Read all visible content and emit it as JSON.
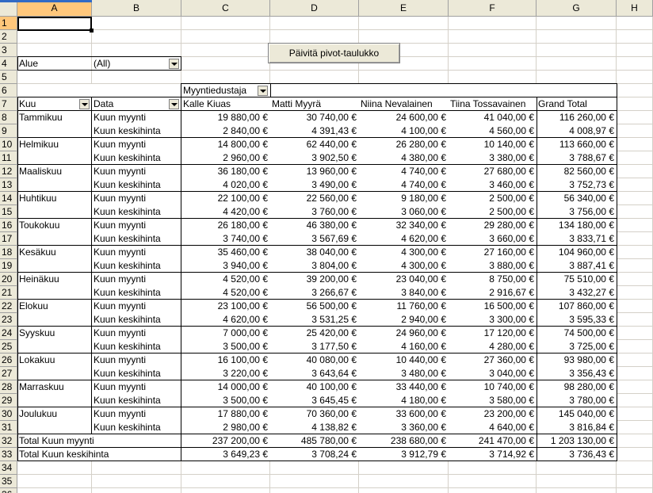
{
  "columns": [
    "A",
    "B",
    "C",
    "D",
    "E",
    "F",
    "G",
    "H"
  ],
  "rows": [
    "1",
    "2",
    "3",
    "4",
    "5",
    "6",
    "7",
    "8",
    "9",
    "10",
    "11",
    "12",
    "13",
    "14",
    "15",
    "16",
    "17",
    "18",
    "19",
    "20",
    "21",
    "22",
    "23",
    "24",
    "25",
    "26",
    "27",
    "28",
    "29",
    "30",
    "31",
    "32",
    "33",
    "34",
    "35",
    "36"
  ],
  "refresh_button": "Päivitä pivot-taulukko",
  "page_field": {
    "label": "Alue",
    "value": "(All)"
  },
  "column_field": "Myyntiedustaja",
  "row_fields": [
    "Kuu",
    "Data"
  ],
  "salespeople": [
    "Kalle  Kiuas",
    "Matti Myyrä",
    "Niina Nevalainen",
    "Tiina Tossavainen",
    "Grand Total"
  ],
  "months": [
    {
      "name": "Tammikuu",
      "sales": [
        "19 880,00 €",
        "30 740,00 €",
        "24 600,00 €",
        "41 040,00 €",
        "116 260,00 €"
      ],
      "avg": [
        "2 840,00 €",
        "4 391,43 €",
        "4 100,00 €",
        "4 560,00 €",
        "4 008,97 €"
      ]
    },
    {
      "name": "Helmikuu",
      "sales": [
        "14 800,00 €",
        "62 440,00 €",
        "26 280,00 €",
        "10 140,00 €",
        "113 660,00 €"
      ],
      "avg": [
        "2 960,00 €",
        "3 902,50 €",
        "4 380,00 €",
        "3 380,00 €",
        "3 788,67 €"
      ]
    },
    {
      "name": "Maaliskuu",
      "sales": [
        "36 180,00 €",
        "13 960,00 €",
        "4 740,00 €",
        "27 680,00 €",
        "82 560,00 €"
      ],
      "avg": [
        "4 020,00 €",
        "3 490,00 €",
        "4 740,00 €",
        "3 460,00 €",
        "3 752,73 €"
      ]
    },
    {
      "name": "Huhtikuu",
      "sales": [
        "22 100,00 €",
        "22 560,00 €",
        "9 180,00 €",
        "2 500,00 €",
        "56 340,00 €"
      ],
      "avg": [
        "4 420,00 €",
        "3 760,00 €",
        "3 060,00 €",
        "2 500,00 €",
        "3 756,00 €"
      ]
    },
    {
      "name": "Toukokuu",
      "sales": [
        "26 180,00 €",
        "46 380,00 €",
        "32 340,00 €",
        "29 280,00 €",
        "134 180,00 €"
      ],
      "avg": [
        "3 740,00 €",
        "3 567,69 €",
        "4 620,00 €",
        "3 660,00 €",
        "3 833,71 €"
      ]
    },
    {
      "name": "Kesäkuu",
      "sales": [
        "35 460,00 €",
        "38 040,00 €",
        "4 300,00 €",
        "27 160,00 €",
        "104 960,00 €"
      ],
      "avg": [
        "3 940,00 €",
        "3 804,00 €",
        "4 300,00 €",
        "3 880,00 €",
        "3 887,41 €"
      ]
    },
    {
      "name": "Heinäkuu",
      "sales": [
        "4 520,00 €",
        "39 200,00 €",
        "23 040,00 €",
        "8 750,00 €",
        "75 510,00 €"
      ],
      "avg": [
        "4 520,00 €",
        "3 266,67 €",
        "3 840,00 €",
        "2 916,67 €",
        "3 432,27 €"
      ]
    },
    {
      "name": "Elokuu",
      "sales": [
        "23 100,00 €",
        "56 500,00 €",
        "11 760,00 €",
        "16 500,00 €",
        "107 860,00 €"
      ],
      "avg": [
        "4 620,00 €",
        "3 531,25 €",
        "2 940,00 €",
        "3 300,00 €",
        "3 595,33 €"
      ]
    },
    {
      "name": "Syyskuu",
      "sales": [
        "7 000,00 €",
        "25 420,00 €",
        "24 960,00 €",
        "17 120,00 €",
        "74 500,00 €"
      ],
      "avg": [
        "3 500,00 €",
        "3 177,50 €",
        "4 160,00 €",
        "4 280,00 €",
        "3 725,00 €"
      ]
    },
    {
      "name": "Lokakuu",
      "sales": [
        "16 100,00 €",
        "40 080,00 €",
        "10 440,00 €",
        "27 360,00 €",
        "93 980,00 €"
      ],
      "avg": [
        "3 220,00 €",
        "3 643,64 €",
        "3 480,00 €",
        "3 040,00 €",
        "3 356,43 €"
      ]
    },
    {
      "name": "Marraskuu",
      "sales": [
        "14 000,00 €",
        "40 100,00 €",
        "33 440,00 €",
        "10 740,00 €",
        "98 280,00 €"
      ],
      "avg": [
        "3 500,00 €",
        "3 645,45 €",
        "4 180,00 €",
        "3 580,00 €",
        "3 780,00 €"
      ]
    },
    {
      "name": "Joulukuu",
      "sales": [
        "17 880,00 €",
        "70 360,00 €",
        "33 600,00 €",
        "23 200,00 €",
        "145 040,00 €"
      ],
      "avg": [
        "2 980,00 €",
        "4 138,82 €",
        "3 360,00 €",
        "4 640,00 €",
        "3 816,84 €"
      ]
    }
  ],
  "data_labels": {
    "sales": "Kuun myynti",
    "avg": "Kuun keskihinta"
  },
  "totals": [
    {
      "label": "Total Kuun myynti",
      "values": [
        "237 200,00 €",
        "485 780,00 €",
        "238 680,00 €",
        "241 470,00 €",
        "1 203 130,00 €"
      ]
    },
    {
      "label": "Total Kuun keskihinta",
      "values": [
        "3 649,23 €",
        "3 708,24 €",
        "3 912,79 €",
        "3 714,92 €",
        "3 736,43 €"
      ]
    }
  ]
}
